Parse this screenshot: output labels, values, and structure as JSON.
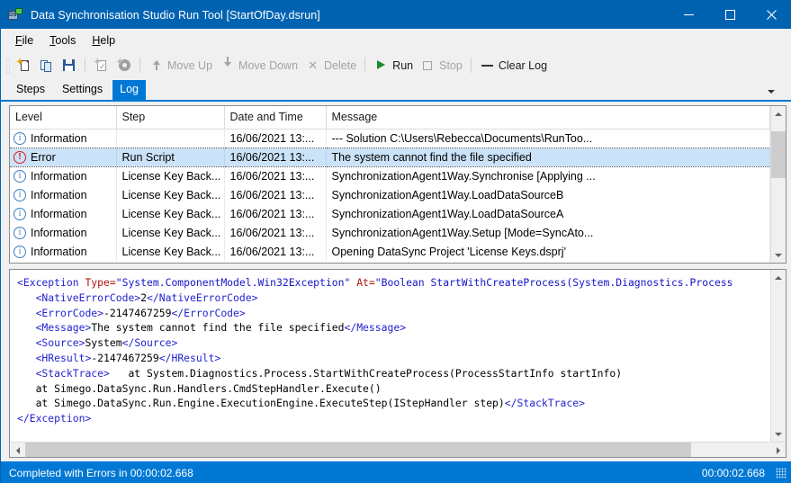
{
  "window": {
    "title": "Data Synchronisation Studio Run Tool [StartOfDay.dsrun]",
    "icon": "app-icon",
    "minimize": "—",
    "maximize": "□",
    "close": "✕"
  },
  "menu": {
    "items": [
      {
        "label": "File",
        "accel": "F",
        "rest": "ile"
      },
      {
        "label": "Tools",
        "accel": "T",
        "rest": "ools"
      },
      {
        "label": "Help",
        "accel": "H",
        "rest": "elp"
      }
    ]
  },
  "toolbar": {
    "buttons": [
      {
        "name": "new",
        "label": "",
        "icon": "new-document-icon",
        "enabled": true
      },
      {
        "name": "duplicate",
        "label": "",
        "icon": "copy-icon",
        "enabled": true
      },
      {
        "name": "save",
        "label": "",
        "icon": "save-icon",
        "enabled": true
      },
      {
        "name": "edit-step",
        "label": "",
        "icon": "edit-document-icon",
        "enabled": false
      },
      {
        "name": "configure",
        "label": "",
        "icon": "gear-icon",
        "enabled": false
      },
      {
        "name": "move-up",
        "label": "Move Up",
        "icon": "arrow-up-icon",
        "enabled": false
      },
      {
        "name": "move-down",
        "label": "Move Down",
        "icon": "arrow-down-icon",
        "enabled": false
      },
      {
        "name": "delete",
        "label": "Delete",
        "icon": "close-x-icon",
        "enabled": false
      },
      {
        "name": "run",
        "label": "Run",
        "icon": "play-icon",
        "enabled": true
      },
      {
        "name": "stop",
        "label": "Stop",
        "icon": "stop-icon",
        "enabled": false
      },
      {
        "name": "clear-log",
        "label": "Clear Log",
        "icon": "dash-icon",
        "enabled": true
      }
    ]
  },
  "tabs": {
    "items": [
      {
        "label": "Steps",
        "active": false
      },
      {
        "label": "Settings",
        "active": false
      },
      {
        "label": "Log",
        "active": true
      }
    ],
    "overflow_icon": "chevron-down-icon"
  },
  "log_grid": {
    "columns": [
      "Level",
      "Step",
      "Date and Time",
      "Message"
    ],
    "rows": [
      {
        "level": "Information",
        "level_icon": "info-icon",
        "step": "",
        "datetime": "16/06/2021 13:...",
        "message": "--- Solution C:\\Users\\Rebecca\\Documents\\RunToo...",
        "selected": false
      },
      {
        "level": "Error",
        "level_icon": "error-icon",
        "step": "Run Script",
        "datetime": "16/06/2021 13:...",
        "message": "The system cannot find the file specified",
        "selected": true
      },
      {
        "level": "Information",
        "level_icon": "info-icon",
        "step": "License Key Back...",
        "datetime": "16/06/2021 13:...",
        "message": "SynchronizationAgent1Way.Synchronise [Applying ...",
        "selected": false
      },
      {
        "level": "Information",
        "level_icon": "info-icon",
        "step": "License Key Back...",
        "datetime": "16/06/2021 13:...",
        "message": "SynchronizationAgent1Way.LoadDataSourceB",
        "selected": false
      },
      {
        "level": "Information",
        "level_icon": "info-icon",
        "step": "License Key Back...",
        "datetime": "16/06/2021 13:...",
        "message": "SynchronizationAgent1Way.LoadDataSourceA",
        "selected": false
      },
      {
        "level": "Information",
        "level_icon": "info-icon",
        "step": "License Key Back...",
        "datetime": "16/06/2021 13:...",
        "message": "SynchronizationAgent1Way.Setup [Mode=SyncAto...",
        "selected": false
      },
      {
        "level": "Information",
        "level_icon": "info-icon",
        "step": "License Key Back...",
        "datetime": "16/06/2021 13:...",
        "message": "Opening DataSync Project 'License Keys.dsprj'",
        "selected": false
      }
    ]
  },
  "detail": {
    "lines": [
      "<Exception Type=\"System.ComponentModel.Win32Exception\" At=\"Boolean StartWithCreateProcess(System.Diagnostics.Process",
      "   <NativeErrorCode>2</NativeErrorCode>",
      "   <ErrorCode>-2147467259</ErrorCode>",
      "   <Message>The system cannot find the file specified</Message>",
      "   <Source>System</Source>",
      "   <HResult>-2147467259</HResult>",
      "   <StackTrace>   at System.Diagnostics.Process.StartWithCreateProcess(ProcessStartInfo startInfo)",
      "   at Simego.DataSync.Run.Handlers.CmdStepHandler.Execute()",
      "   at Simego.DataSync.Run.Engine.ExecutionEngine.ExecuteStep(IStepHandler step)</StackTrace>",
      "</Exception>"
    ]
  },
  "statusbar": {
    "message": "Completed with Errors in 00:00:02.668",
    "elapsed": "00:00:02.668"
  },
  "colors": {
    "accent": "#0078d4",
    "titlebar": "#0063b1",
    "selection": "#cbe3f8",
    "error": "#e01b1b",
    "info": "#3a7fc2",
    "run_green": "#1d8a2e"
  }
}
